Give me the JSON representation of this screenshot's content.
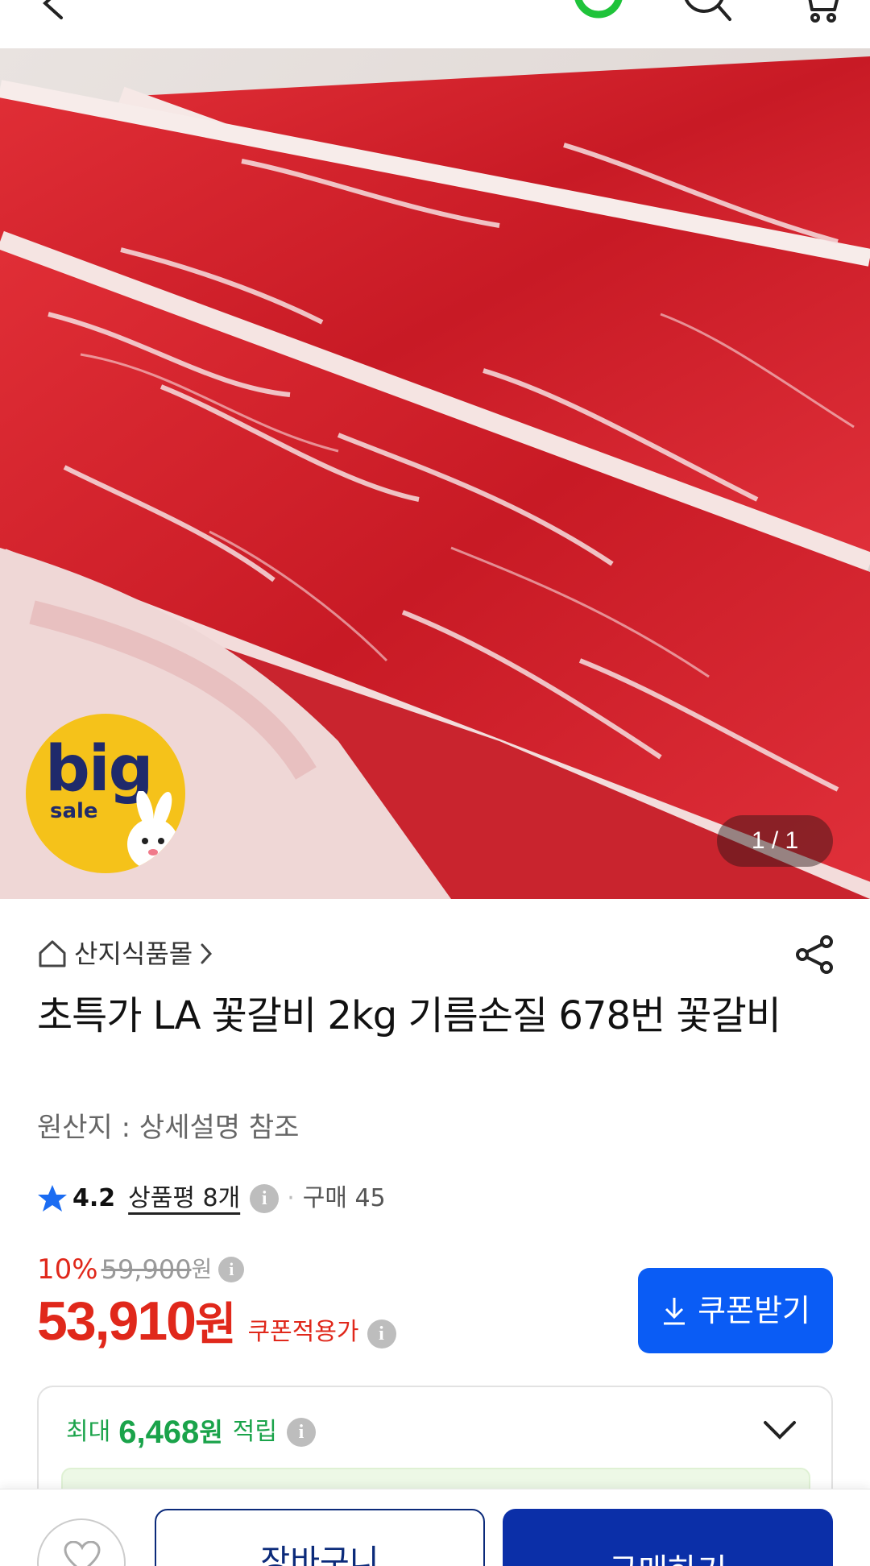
{
  "header": {
    "back_icon": "chevron-left-icon",
    "icons": [
      "green-ring-icon",
      "search-icon",
      "cart-icon"
    ]
  },
  "hero": {
    "badge": {
      "big": "big",
      "sale": "sale"
    },
    "pager": "1 / 1"
  },
  "product": {
    "store": "산지식품몰",
    "title": "초특가 LA 꽃갈비 2kg 기름손질 678번 꽃갈비",
    "origin": "원산지 : 상세설명 참조",
    "rating": "4.2",
    "reviews": "상품평 8개",
    "purchases": "구매 45",
    "discount": "10%",
    "original_price": "59,900",
    "original_unit": "원",
    "price": "53,910",
    "price_unit": "원",
    "coupon_price_label": "쿠폰적용가"
  },
  "coupon_button": {
    "label": "쿠폰받기"
  },
  "points": {
    "max_label": "최대",
    "amount": "6,468",
    "unit": "원",
    "suffix": "적립"
  },
  "bottom": {
    "cart_label": "장바구니",
    "buy_label": "구매하기"
  },
  "colors": {
    "price_red": "#e0281b",
    "coupon_blue": "#0a5cf5",
    "points_green": "#1aa34a",
    "buy_navy": "#0b2fa8"
  }
}
